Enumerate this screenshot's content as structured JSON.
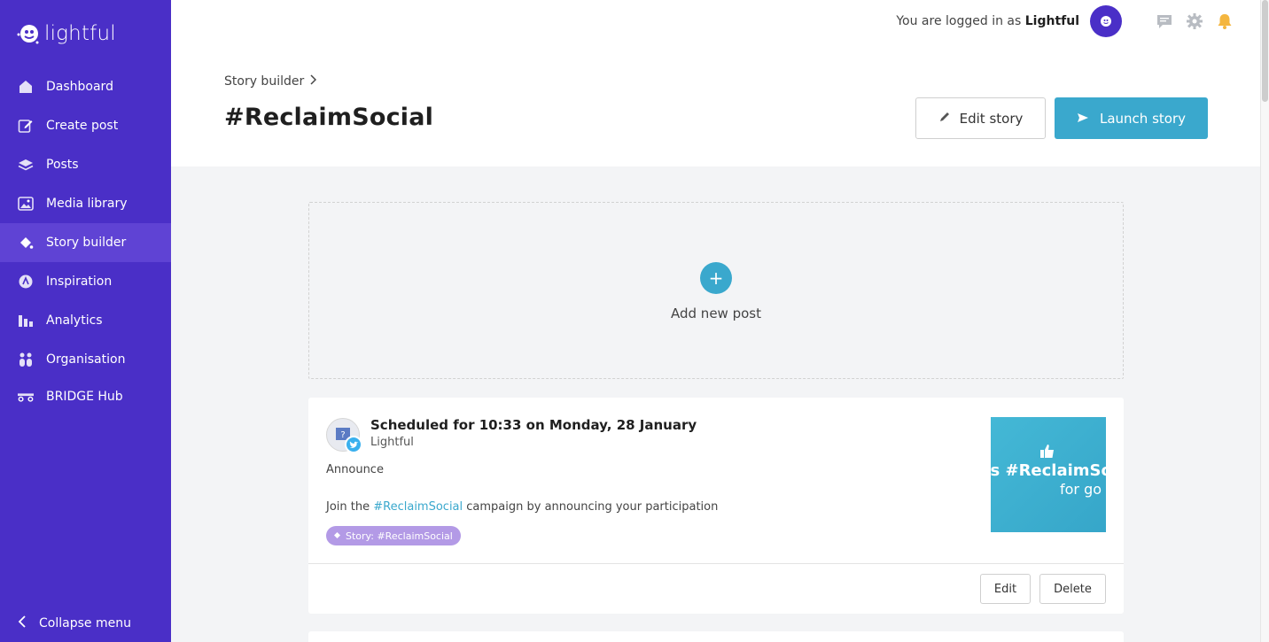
{
  "brand": {
    "name": "lightful",
    "accent": "#4a2fc7",
    "primary_button": "#3aa8cd"
  },
  "sidebar": {
    "items": [
      {
        "label": "Dashboard",
        "icon": "home-icon"
      },
      {
        "label": "Create post",
        "icon": "edit-icon"
      },
      {
        "label": "Posts",
        "icon": "layers-icon"
      },
      {
        "label": "Media library",
        "icon": "image-icon"
      },
      {
        "label": "Story builder",
        "icon": "paint-bucket-icon",
        "active": true
      },
      {
        "label": "Inspiration",
        "icon": "lightbulb-icon"
      },
      {
        "label": "Analytics",
        "icon": "bar-chart-icon"
      },
      {
        "label": "Organisation",
        "icon": "people-icon"
      },
      {
        "label": "BRIDGE Hub",
        "icon": "bridge-icon"
      }
    ],
    "collapse_label": "Collapse menu"
  },
  "header": {
    "logged_in_prefix": "You are logged in as",
    "user_name": "Lightful"
  },
  "page": {
    "breadcrumb": "Story builder",
    "title": "#ReclaimSocial",
    "edit_story_label": "Edit story",
    "launch_story_label": "Launch story"
  },
  "add_post": {
    "label": "Add new post",
    "plus": "+"
  },
  "post": {
    "schedule": "Scheduled for 10:33 on Monday, 28 January",
    "author": "Lightful",
    "title": "Announce",
    "body_prefix": "Join the",
    "hashtag": "#ReclaimSocial",
    "body_suffix": "campaign by announcing your participation",
    "story_tag": "Story: #ReclaimSocial",
    "thumb_line1": "'s #ReclaimSoc",
    "thumb_line2": "for go",
    "edit_label": "Edit",
    "delete_label": "Delete"
  }
}
